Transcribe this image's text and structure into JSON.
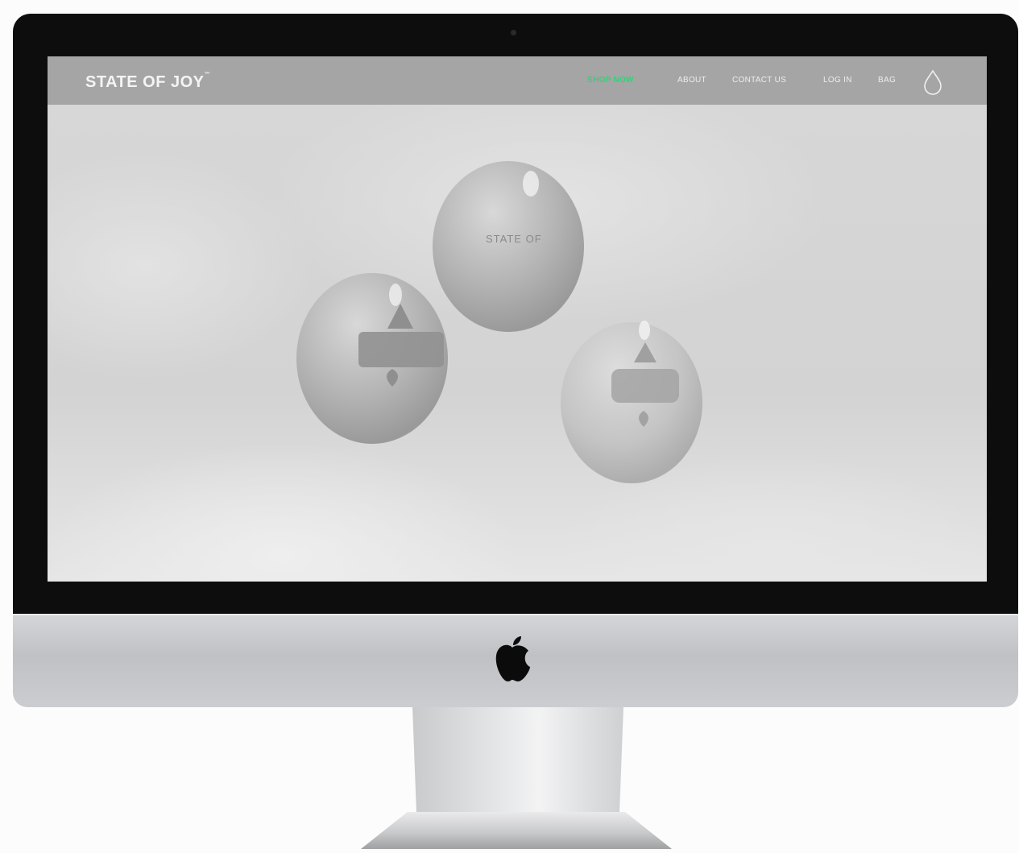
{
  "site": {
    "logo": "STATE OF JOY",
    "logo_mark": "™",
    "nav": [
      {
        "label": "SHOP NOW",
        "active": true
      },
      {
        "label": "ABOUT",
        "active": false
      },
      {
        "label": "CONTACT US",
        "active": false
      },
      {
        "label": "LOG IN",
        "active": false
      },
      {
        "label": "BAG",
        "active": false
      }
    ],
    "cart_icon": "drop-icon",
    "accent_color": "#36d07c",
    "header_color": "#a5a5a5"
  },
  "hero": {
    "balloon_print_text": "STATE OF"
  },
  "device": {
    "logo_icon": "apple-icon"
  }
}
